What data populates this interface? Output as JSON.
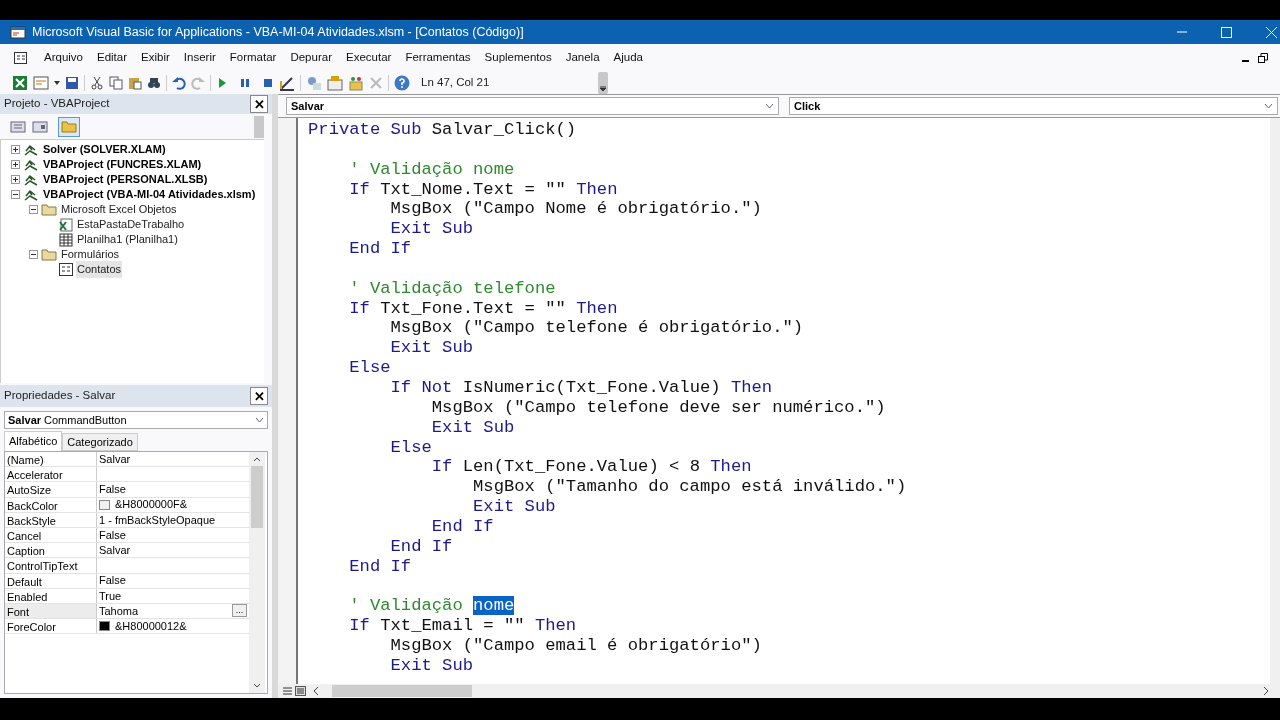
{
  "window": {
    "title": "Microsoft Visual Basic for Applications - VBA-MI-04 Atividades.xlsm - [Contatos (Código)]"
  },
  "menu": [
    "Arquivo",
    "Editar",
    "Exibir",
    "Inserir",
    "Formatar",
    "Depurar",
    "Executar",
    "Ferramentas",
    "Suplementos",
    "Janela",
    "Ajuda"
  ],
  "toolbar": {
    "position": "Ln 47, Col 21"
  },
  "project": {
    "title": "Projeto - VBAProject",
    "close": "✕",
    "tree": [
      {
        "kind": "project",
        "label": "Solver (SOLVER.XLAM)",
        "expanded": false,
        "selected": false
      },
      {
        "kind": "project",
        "label": "VBAProject (FUNCRES.XLAM)",
        "expanded": false,
        "selected": false
      },
      {
        "kind": "project",
        "label": "VBAProject (PERSONAL.XLSB)",
        "expanded": false,
        "selected": false
      },
      {
        "kind": "project",
        "label": "VBAProject (VBA-MI-04 Atividades.xlsm)",
        "expanded": true,
        "selected": false,
        "children": [
          {
            "kind": "folder",
            "label": "Microsoft Excel Objetos",
            "expanded": true,
            "selected": false,
            "children": [
              {
                "kind": "workbook",
                "label": "EstaPastaDeTrabalho",
                "selected": false
              },
              {
                "kind": "sheet",
                "label": "Planilha1 (Planilha1)",
                "selected": false
              }
            ]
          },
          {
            "kind": "folder",
            "label": "Formulários",
            "expanded": true,
            "selected": false,
            "children": [
              {
                "kind": "form",
                "label": "Contatos",
                "selected": true
              }
            ]
          }
        ]
      }
    ]
  },
  "properties": {
    "title": "Propriedades - Salvar",
    "close": "✕",
    "object_name": "Salvar",
    "object_type": "CommandButton",
    "tabs": [
      {
        "label": "Alfabético",
        "selected": true
      },
      {
        "label": "Categorizado",
        "selected": false
      }
    ],
    "rows": [
      {
        "name": "(Name)",
        "value": "Salvar",
        "selected": false
      },
      {
        "name": "Accelerator",
        "selected": false
      },
      {
        "name": "AutoSize",
        "value": "False",
        "selected": false
      },
      {
        "name": "BackColor",
        "value": "&H8000000F&",
        "color": "#f0f0f0",
        "selected": false
      },
      {
        "name": "BackStyle",
        "value": "1 - fmBackStyleOpaque",
        "selected": false
      },
      {
        "name": "Cancel",
        "value": "False",
        "selected": false
      },
      {
        "name": "Caption",
        "value": "Salvar",
        "selected": false
      },
      {
        "name": "ControlTipText",
        "selected": false
      },
      {
        "name": "Default",
        "value": "False",
        "selected": false
      },
      {
        "name": "Enabled",
        "value": "True",
        "selected": false
      },
      {
        "name": "Font",
        "value": "Tahoma",
        "button": "...",
        "selected": true
      },
      {
        "name": "ForeColor",
        "value": "&H80000012&",
        "color": "#000000",
        "selected": false
      }
    ]
  },
  "code": {
    "object": "Salvar",
    "procedure": "Click",
    "lines": [
      {
        "tokens": [
          {
            "kind": "keyword",
            "text": "Private Sub"
          },
          {
            "kind": "plain",
            "text": " Salvar_Click()"
          }
        ]
      },
      {
        "space_before": true,
        "tokens": [
          {
            "kind": "comment",
            "text": "    ' Validação nome"
          }
        ]
      },
      {
        "tokens": [
          {
            "kind": "keyword",
            "text": "    If"
          },
          {
            "kind": "plain",
            "text": " Txt_Nome.Text = \"\" "
          },
          {
            "kind": "keyword",
            "text": "Then"
          }
        ]
      },
      {
        "tokens": [
          {
            "kind": "plain",
            "text": "        MsgBox (\"Campo Nome é obrigatório.\")"
          }
        ]
      },
      {
        "tokens": [
          {
            "kind": "keyword",
            "text": "        Exit Sub"
          }
        ]
      },
      {
        "tokens": [
          {
            "kind": "keyword",
            "text": "    End If"
          }
        ]
      },
      {
        "space_before": true,
        "tokens": [
          {
            "kind": "comment",
            "text": "    ' Validação telefone"
          }
        ]
      },
      {
        "tokens": [
          {
            "kind": "keyword",
            "text": "    If"
          },
          {
            "kind": "plain",
            "text": " Txt_Fone.Text = \"\" "
          },
          {
            "kind": "keyword",
            "text": "Then"
          }
        ]
      },
      {
        "tokens": [
          {
            "kind": "plain",
            "text": "        MsgBox (\"Campo telefone é obrigatório.\")"
          }
        ]
      },
      {
        "tokens": [
          {
            "kind": "keyword",
            "text": "        Exit Sub"
          }
        ]
      },
      {
        "tokens": [
          {
            "kind": "keyword",
            "text": "    Else"
          }
        ]
      },
      {
        "tokens": [
          {
            "kind": "keyword",
            "text": "        If Not"
          },
          {
            "kind": "plain",
            "text": " IsNumeric(Txt_Fone.Value) "
          },
          {
            "kind": "keyword",
            "text": "Then"
          }
        ]
      },
      {
        "tokens": [
          {
            "kind": "plain",
            "text": "            MsgBox (\"Campo telefone deve ser numérico.\")"
          }
        ]
      },
      {
        "tokens": [
          {
            "kind": "keyword",
            "text": "            Exit Sub"
          }
        ]
      },
      {
        "tokens": [
          {
            "kind": "keyword",
            "text": "        Else"
          }
        ]
      },
      {
        "tokens": [
          {
            "kind": "keyword",
            "text": "            If"
          },
          {
            "kind": "plain",
            "text": " Len(Txt_Fone.Value) < 8 "
          },
          {
            "kind": "keyword",
            "text": "Then"
          }
        ]
      },
      {
        "tokens": [
          {
            "kind": "plain",
            "text": "                MsgBox (\"Tamanho do campo está inválido.\")"
          }
        ]
      },
      {
        "tokens": [
          {
            "kind": "keyword",
            "text": "                Exit Sub"
          }
        ]
      },
      {
        "tokens": [
          {
            "kind": "keyword",
            "text": "            End If"
          }
        ]
      },
      {
        "tokens": [
          {
            "kind": "keyword",
            "text": "        End If"
          }
        ]
      },
      {
        "tokens": [
          {
            "kind": "keyword",
            "text": "    End If"
          }
        ]
      },
      {
        "space_before": true,
        "tokens": [
          {
            "kind": "comment",
            "text": "    ' Validação "
          },
          {
            "kind": "selected",
            "text": "nome"
          }
        ]
      },
      {
        "tokens": [
          {
            "kind": "keyword",
            "text": "    If"
          },
          {
            "kind": "plain",
            "text": " Txt_Email = \"\" "
          },
          {
            "kind": "keyword",
            "text": "Then"
          }
        ]
      },
      {
        "tokens": [
          {
            "kind": "plain",
            "text": "        MsgBox (\"Campo email é obrigatório\")"
          }
        ]
      },
      {
        "tokens": [
          {
            "kind": "keyword",
            "text": "        Exit Sub"
          }
        ]
      }
    ]
  }
}
